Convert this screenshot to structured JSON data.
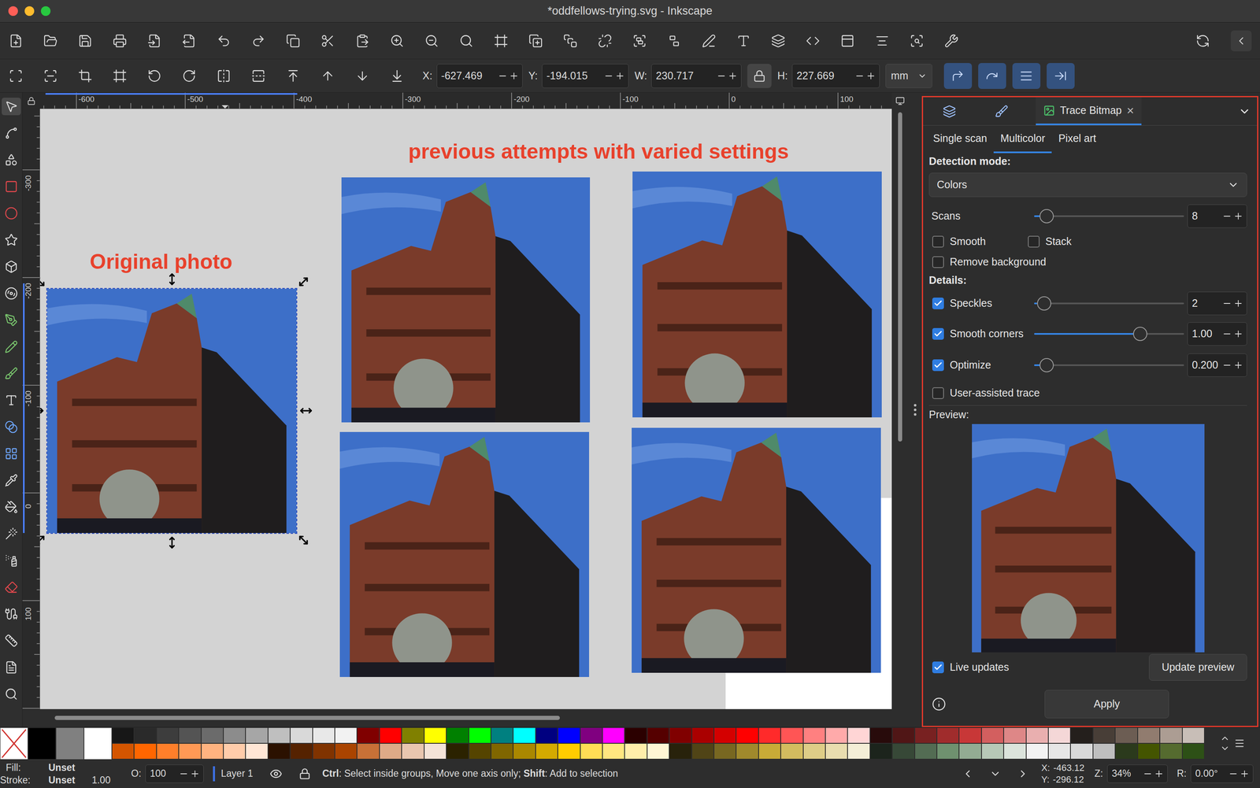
{
  "window": {
    "title": "*oddfellows-trying.svg - Inkscape"
  },
  "tools": [
    {
      "selected": true
    },
    {
      "selected": false
    },
    {
      "selected": false
    },
    {
      "selected": false
    },
    {
      "selected": false
    },
    {
      "selected": false
    },
    {
      "selected": false
    },
    {
      "selected": false
    },
    {
      "selected": false
    },
    {
      "selected": false
    },
    {
      "selected": false
    },
    {
      "selected": false
    },
    {
      "selected": false
    },
    {
      "selected": false
    },
    {
      "selected": false
    },
    {
      "selected": false
    },
    {
      "selected": false
    },
    {
      "selected": false
    },
    {
      "selected": false
    },
    {
      "selected": false
    },
    {
      "selected": false
    },
    {
      "selected": false
    },
    {
      "selected": false
    }
  ],
  "fields": [
    {
      "label": "X:",
      "value": "-627.469"
    },
    {
      "label": "Y:",
      "value": "-194.015"
    },
    {
      "label": "W:",
      "value": "230.717"
    },
    {
      "label": "H:",
      "value": "227.669"
    }
  ],
  "lock": {
    "locked": true
  },
  "unit": "mm",
  "rulers": {
    "top": [
      "-600",
      "-500",
      "-400",
      "-300",
      "-200",
      "-100",
      "0",
      "100"
    ],
    "left": [
      "-300",
      "-200",
      "-100",
      "0",
      "100"
    ]
  },
  "canvas": {
    "original_label": "Original photo",
    "attempts_label": "previous attempts with varied settings",
    "photos": [
      {
        "selected": true
      },
      {
        "selected": false
      },
      {
        "selected": false
      },
      {
        "selected": false
      },
      {
        "selected": false
      }
    ]
  },
  "dock": {
    "tabs": [
      {
        "kind": "icon",
        "selected": false
      },
      {
        "kind": "icon",
        "selected": false
      },
      {
        "kind": "text",
        "label": "Trace Bitmap",
        "close": "×",
        "selected": true
      }
    ],
    "modes": [
      {
        "label": "Single scan",
        "selected": false
      },
      {
        "label": "Multicolor",
        "selected": true
      },
      {
        "label": "Pixel art",
        "selected": false
      }
    ],
    "detection": {
      "label": "Detection mode:",
      "value": "Colors"
    },
    "scans": {
      "label": "Scans",
      "level": 0.04,
      "value": "8"
    },
    "options": [
      {
        "label": "Smooth",
        "checked": false
      },
      {
        "label": "Stack",
        "checked": false
      },
      {
        "label": "Remove background",
        "checked": false
      }
    ],
    "details_label": "Details:",
    "details": [
      {
        "label": "Speckles",
        "checked": true,
        "level": 0.02,
        "value": "2"
      },
      {
        "label": "Smooth corners",
        "checked": true,
        "level": 0.73,
        "value": "1.00"
      },
      {
        "label": "Optimize",
        "checked": true,
        "level": 0.04,
        "value": "0.200"
      }
    ],
    "user_assisted": {
      "label": "User-assisted trace",
      "checked": false
    },
    "preview_label": "Preview:",
    "live_updates": {
      "label": "Live updates",
      "checked": true
    },
    "update_button": "Update preview",
    "apply_button": "Apply"
  },
  "palette": {
    "main": [
      {
        "kind": "none",
        "color": "#ffffff"
      },
      {
        "kind": "color",
        "color": "#000000"
      },
      {
        "kind": "color",
        "color": "#808080"
      },
      {
        "kind": "color",
        "color": "#ffffff"
      }
    ],
    "rows": [
      [
        "#171717",
        "#2a2a2a",
        "#3d3d3d",
        "#545454",
        "#6b6b6b",
        "#8c8c8c",
        "#a6a6a6",
        "#bfbfbf",
        "#d9d9d9",
        "#e8e8e8",
        "#f2f2f2",
        "#800000",
        "#ff0000",
        "#808000",
        "#ffff00",
        "#008000",
        "#00ff00",
        "#008080",
        "#00ffff",
        "#000080",
        "#0000ff",
        "#800080",
        "#ff00ff",
        "#2b0000",
        "#550000",
        "#800000",
        "#aa0000",
        "#d40000",
        "#ff0000",
        "#ff2a2a",
        "#ff5555",
        "#ff8080",
        "#ffaaaa",
        "#ffd5d5",
        "#280b0b",
        "#501616",
        "#782121",
        "#a02c2c",
        "#c83737",
        "#d35f5f",
        "#de8787",
        "#e9afaf",
        "#f4d7d7",
        "#241f1c",
        "#483e37",
        "#6c5d53",
        "#917c6f",
        "#ac9d93",
        "#c8beb7"
      ],
      [
        "#d45500",
        "#ff6600",
        "#ff7f2a",
        "#ff9955",
        "#ffb380",
        "#ffccaa",
        "#ffe6d5",
        "#2b1100",
        "#552200",
        "#803300",
        "#aa4400",
        "#c87137",
        "#deaa87",
        "#e9c6af",
        "#f4e3d7",
        "#2b2200",
        "#554400",
        "#806600",
        "#aa8800",
        "#d4aa00",
        "#ffcc00",
        "#ffdd55",
        "#ffe680",
        "#ffeeaa",
        "#fff6d5",
        "#28220b",
        "#504416",
        "#786721",
        "#a0892c",
        "#c8ab37",
        "#d3bc5f",
        "#decd87",
        "#e9ddaf",
        "#f4eed7",
        "#1c241c",
        "#374837",
        "#536c53",
        "#6f916f",
        "#93ac93",
        "#b7c8b7",
        "#dbe3db",
        "#f2f2f2",
        "#e6e6e6",
        "#d9d9d9",
        "#bfbfbf",
        "#2b3a1c",
        "#445500",
        "#556b2f",
        "#2d5016"
      ]
    ]
  },
  "status": {
    "fill_label": "Fill:",
    "fill": "Unset",
    "stroke_label": "Stroke:",
    "stroke": "Unset",
    "stroke_width": "1.00",
    "opacity_label": "O:",
    "opacity": "100",
    "layer": "Layer 1",
    "message": [
      {
        "text": "Ctrl",
        "bold": true
      },
      {
        "text": ": Select inside groups, Move one axis only; ",
        "bold": false
      },
      {
        "text": "Shift",
        "bold": true
      },
      {
        "text": ": Add to selection",
        "bold": false
      }
    ],
    "cursor_x_label": "X:",
    "cursor_x": "-463.12",
    "cursor_y_label": "Y:",
    "cursor_y": "-296.12",
    "zoom_label": "Z:",
    "zoom": "34%",
    "rotation_label": "R:",
    "rotation": "0.00°"
  }
}
